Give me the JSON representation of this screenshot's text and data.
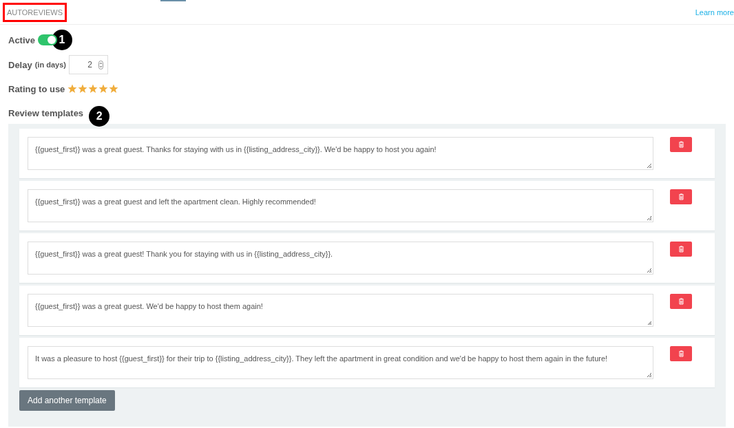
{
  "header": {
    "title": "AUTOREVIEWS",
    "link": "Learn more"
  },
  "active": {
    "label": "Active",
    "on": true,
    "marker": "1"
  },
  "delay": {
    "label": "Delay",
    "hint": "(in days)",
    "value": "2"
  },
  "rating": {
    "label": "Rating to use",
    "stars": 5
  },
  "templates": {
    "label": "Review templates",
    "marker": "2",
    "items": [
      {
        "text": "{{guest_first}} was a great guest. Thanks for staying with us in {{listing_address_city}}. We'd be happy to host you again!"
      },
      {
        "text": "{{guest_first}} was a great guest and left the apartment clean. Highly recommended!"
      },
      {
        "text": "{{guest_first}} was a great guest! Thank you for staying with us in {{listing_address_city}}."
      },
      {
        "text": "{{guest_first}} was a great guest. We'd be happy to host them again!"
      },
      {
        "text": "It was a pleasure to host {{guest_first}} for their trip to {{listing_address_city}}. They left the apartment in great condition and we'd be happy to host them again in the future!"
      }
    ],
    "add_button": "Add another template"
  }
}
